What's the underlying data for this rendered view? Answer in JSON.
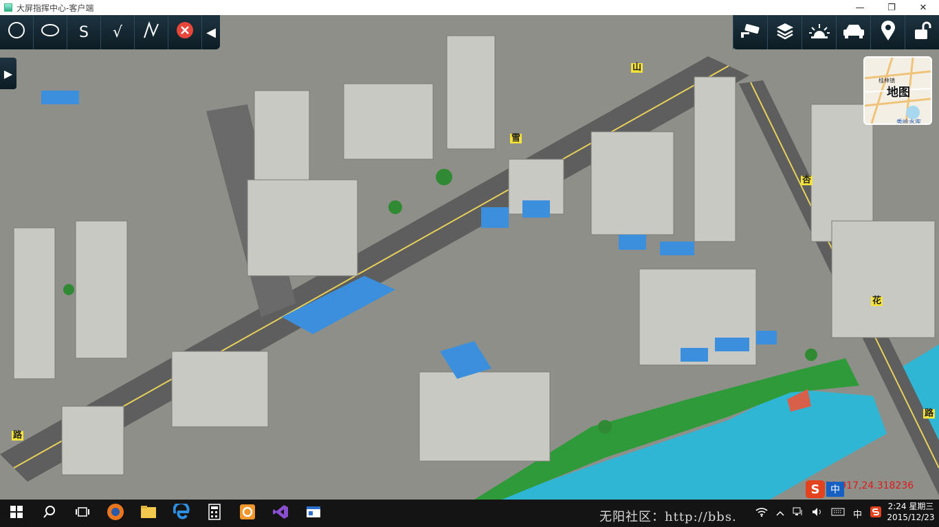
{
  "window": {
    "title": "大屏指挥中心-客户端",
    "minimize": "—",
    "maximize": "❐",
    "close": "✕"
  },
  "toolbar_left": {
    "tools": [
      {
        "name": "circle-tool",
        "icon": "circle-icon",
        "glyph": "○"
      },
      {
        "name": "ellipse-tool",
        "icon": "ellipse-icon",
        "glyph": "⬭"
      },
      {
        "name": "curve-tool",
        "icon": "s-curve-icon",
        "glyph": "S"
      },
      {
        "name": "check-tool",
        "icon": "checkmark-icon",
        "glyph": "√"
      },
      {
        "name": "polyline-tool",
        "icon": "polyline-icon",
        "glyph": "⋀"
      },
      {
        "name": "clear-tool",
        "icon": "close-circle-icon",
        "glyph": "✕"
      }
    ],
    "collapse_glyph": "◀"
  },
  "side_toggle": {
    "glyph": "▶"
  },
  "toolbar_right": {
    "tools": [
      {
        "name": "camera-tool",
        "icon": "surveillance-camera-icon"
      },
      {
        "name": "layers-tool",
        "icon": "layers-icon"
      },
      {
        "name": "light-tool",
        "icon": "light-beacon-icon"
      },
      {
        "name": "vehicle-tool",
        "icon": "car-icon"
      },
      {
        "name": "location-tool",
        "icon": "map-pin-icon"
      },
      {
        "name": "unlock-tool",
        "icon": "unlock-icon"
      }
    ]
  },
  "minimap": {
    "label": "地图",
    "place_top": "桂林镇",
    "place_bottom": "秀岭水库"
  },
  "road_labels": [
    "山",
    "雪",
    "杏",
    "花",
    "路",
    "路"
  ],
  "ime": {
    "logo": "S",
    "lang": "中"
  },
  "coordinates": "10.917,24.318236",
  "colors": {
    "toolbar_bg": "#12262f",
    "water": "#2fb6d4",
    "roof_blue": "#3c8fdc",
    "coord_red": "#e01818"
  },
  "taskbar": {
    "watermark": "无阳社区：http://bbs.",
    "tray_lang": "中",
    "time": "2:24 星期三",
    "date": "2015/12/23"
  }
}
